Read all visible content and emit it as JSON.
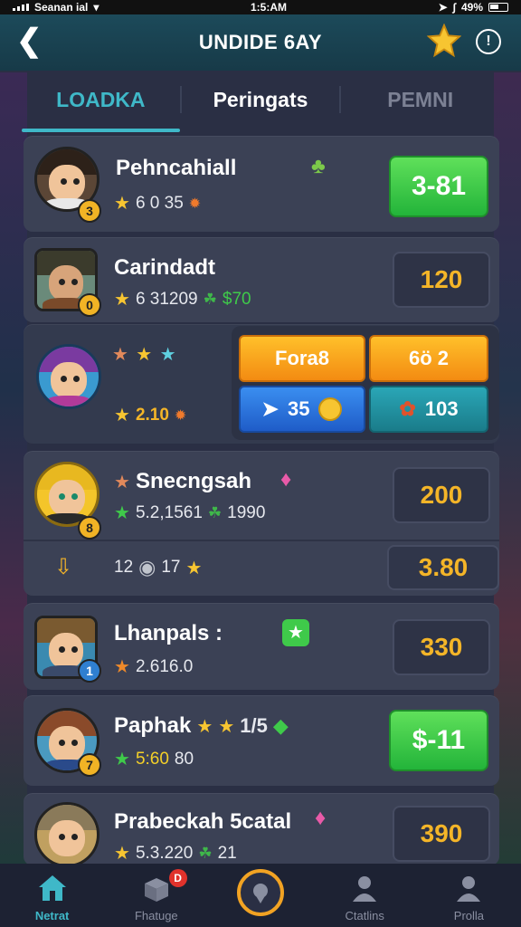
{
  "status_bar": {
    "carrier": "Seanan ial",
    "time": "1:5:AM",
    "battery": "49%"
  },
  "header": {
    "title": "UNDIDE 6AY",
    "back_icon": "back-arrow-icon",
    "star_icon": "star-icon",
    "info_icon": "info-icon"
  },
  "tabs": [
    {
      "label": "LOADKA",
      "active": true
    },
    {
      "label": "Peringats",
      "active": false
    },
    {
      "label": "PEMNI",
      "active": false
    }
  ],
  "rows": [
    {
      "name": "Pehncahiall",
      "level": "3",
      "stat": "6 0 35",
      "score": "3-81",
      "score_style": "green"
    },
    {
      "name": "Carindadt",
      "level": "0",
      "stat": "6 31209",
      "stat_extra": "$70",
      "score": "120",
      "score_style": "dark"
    },
    {
      "stat": "2.10",
      "panel": {
        "btn1": "Fora8",
        "btn2": "6ö 2",
        "btn3": "35",
        "btn4": "103"
      }
    },
    {
      "name": "Snecngsah",
      "level": "8",
      "stat": "5.2,1561",
      "stat_extra": "1990",
      "score": "200",
      "score_style": "dark",
      "sub_stat_a": "12",
      "sub_stat_b": "17",
      "sub_score": "3.80"
    },
    {
      "name": "Lhanpals :",
      "level": "1",
      "stat": "2.616.0",
      "score": "330",
      "score_style": "dark"
    },
    {
      "name": "Paphak",
      "name_extra": "1⁠/5",
      "level": "7",
      "stat": "5:60",
      "stat_extra": "80",
      "score": "$-11",
      "score_style": "green"
    },
    {
      "name": "Prabeckah 5catal",
      "level": "",
      "stat": "5.3.220",
      "stat_extra": "21",
      "score": "390",
      "score_style": "dark"
    }
  ],
  "bottom_nav": [
    {
      "label": "Netrat",
      "icon": "home-icon",
      "active": true
    },
    {
      "label": "Fhatuge",
      "icon": "shop-icon",
      "badge": "D"
    },
    {
      "label": "",
      "icon": "play-circle-icon"
    },
    {
      "label": "Ctatlins",
      "icon": "profile-icon"
    },
    {
      "label": "Prolla",
      "icon": "user-icon"
    }
  ]
}
